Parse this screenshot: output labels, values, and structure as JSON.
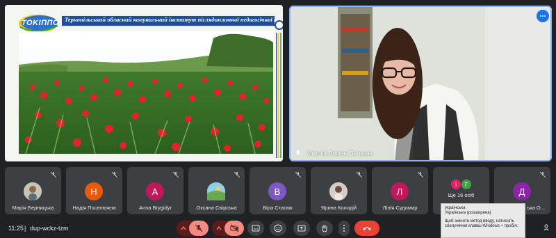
{
  "presentation": {
    "logo_text": "TOKIППО",
    "header_title": "Тернопільський обласний комунальний інститут післядипломної педагогічної освіти"
  },
  "speaker": {
    "name": "Миколів Зоряна Петрівна"
  },
  "participants": [
    {
      "name": "Марія Берне­цька",
      "display": "Марія Берницька",
      "avatar_type": "photo",
      "avatar_color": "#9aa0a6",
      "initial": ""
    },
    {
      "name": "Надія Поселюжна",
      "display": "Надія Поселюжна",
      "avatar_type": "letter",
      "avatar_color": "#e8590c",
      "initial": "Н"
    },
    {
      "name": "Anna Brygidyr",
      "display": "Anna Brygidyr",
      "avatar_type": "letter",
      "avatar_color": "#c2185b",
      "initial": "A"
    },
    {
      "name": "Оксана Свірська",
      "display": "Оксана Свірська",
      "avatar_type": "photo",
      "avatar_color": "#7cb342",
      "initial": ""
    },
    {
      "name": "Віра Стасюк",
      "display": "Віра Стасюк",
      "avatar_type": "letter",
      "avatar_color": "#7e57c2",
      "initial": "В"
    },
    {
      "name": "Ярина Колодій",
      "display": "Ярина Колодій",
      "avatar_type": "photo",
      "avatar_color": "#a1887f",
      "initial": ""
    },
    {
      "name": "Лілія Судомир",
      "display": "Лілія Судомир",
      "avatar_type": "letter",
      "avatar_color": "#c2185b",
      "initial": "Л"
    },
    {
      "name": "Ще 16 осіб",
      "display": "Ще 16 осіб",
      "avatar_type": "group",
      "avatar_color": "#e91e63",
      "initial": "І",
      "initial2": "Г"
    },
    {
      "name": "Любомира О...",
      "display": "ька О...",
      "avatar_type": "letter",
      "avatar_color": "#8e24aa",
      "initial": "Д"
    }
  ],
  "bottom_bar": {
    "time": "11:25",
    "separator": "|",
    "meeting_code": "dup-wckz-tzm"
  },
  "tooltip": {
    "line1": "українська",
    "line2": "Українська (розширена)",
    "line3": "Щоб змінити метод вводу, натисніть",
    "line4": "сполучення клавіш Windows + пробіл."
  },
  "icons": {
    "mic": "mic-off-icon",
    "camera": "camera-off-icon",
    "captions": "captions-icon",
    "emoji": "emoji-icon",
    "present": "present-icon",
    "hand": "raise-hand-icon",
    "more": "more-vert-icon",
    "end": "end-call-icon"
  },
  "colors": {
    "background": "#202124",
    "tile": "#3c4043",
    "accent": "#8ab4f8",
    "end_call": "#ea4335"
  }
}
